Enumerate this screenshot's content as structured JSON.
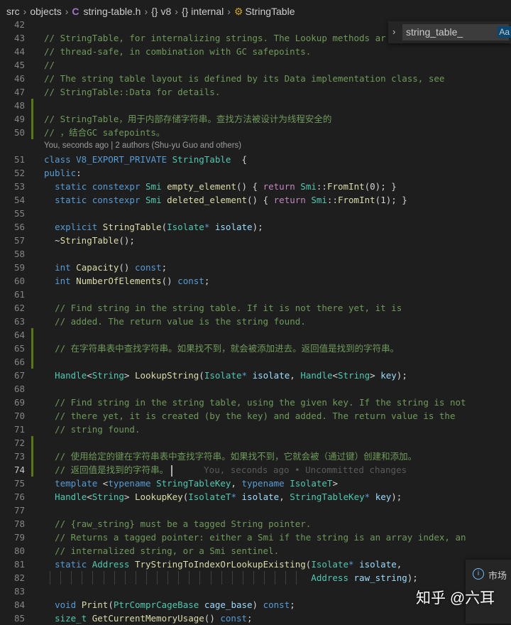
{
  "breadcrumb": [
    "src",
    "objects",
    "string-table.h",
    "v8",
    "internal",
    "StringTable"
  ],
  "find": {
    "value": "string_table_",
    "match_case_label": "Aa"
  },
  "colors": {
    "background": "#1e1e1e",
    "comment": "#6f9a5a",
    "keyword": "#569cd6",
    "type": "#4ec9b0",
    "function": "#dcdcaa",
    "control": "#c586c0",
    "variable": "#9cdcfe",
    "modified_gutter": "#587c0c"
  },
  "blame_header": "You, seconds ago | 2 authors (Shu-yu Guo and others)",
  "ghost_blame": "You, seconds ago • Uncommitted changes",
  "notification": {
    "icon": "info-icon",
    "text": "市场"
  },
  "watermark": "知乎 @六耳",
  "lines": [
    {
      "n": "42",
      "t": []
    },
    {
      "n": "43",
      "t": [
        [
          "c",
          "// StringTable, for internalizing strings. The Lookup methods ar"
        ]
      ]
    },
    {
      "n": "44",
      "t": [
        [
          "c",
          "// thread-safe, in combination with GC safepoints."
        ]
      ]
    },
    {
      "n": "45",
      "t": [
        [
          "c",
          "//"
        ]
      ]
    },
    {
      "n": "46",
      "t": [
        [
          "c",
          "// The string table layout is defined by its Data implementation class, see"
        ]
      ]
    },
    {
      "n": "47",
      "t": [
        [
          "c",
          "// StringTable::Data for details."
        ]
      ]
    },
    {
      "n": "48",
      "m": true,
      "t": []
    },
    {
      "n": "49",
      "m": true,
      "t": [
        [
          "c",
          "// StringTable，用于内部存储字符串。查找方法被设计为线程安全的"
        ]
      ]
    },
    {
      "n": "50",
      "m": true,
      "t": [
        [
          "c",
          "// ，结合GC safepoints。"
        ]
      ],
      "blame": true
    },
    {
      "n": "51",
      "t": [
        [
          "k",
          "class "
        ],
        [
          "k",
          "V8_EXPORT_PRIVATE "
        ],
        [
          "t",
          "StringTable"
        ],
        [
          "",
          "  {"
        ]
      ]
    },
    {
      "n": "52",
      "t": [
        [
          "",
          ""
        ],
        [
          "k",
          "public"
        ],
        [
          "",
          ":"
        ]
      ]
    },
    {
      "n": "53",
      "t": [
        [
          "",
          "  "
        ],
        [
          "k",
          "static "
        ],
        [
          "k",
          "constexpr "
        ],
        [
          "t",
          "Smi "
        ],
        [
          "f",
          "empty_element"
        ],
        [
          "",
          "() { "
        ],
        [
          "r",
          "return "
        ],
        [
          "t",
          "Smi"
        ],
        [
          "",
          "::"
        ],
        [
          "f",
          "FromInt"
        ],
        [
          "",
          "(0); }"
        ]
      ]
    },
    {
      "n": "54",
      "t": [
        [
          "",
          "  "
        ],
        [
          "k",
          "static "
        ],
        [
          "k",
          "constexpr "
        ],
        [
          "t",
          "Smi "
        ],
        [
          "f",
          "deleted_element"
        ],
        [
          "",
          "() { "
        ],
        [
          "r",
          "return "
        ],
        [
          "t",
          "Smi"
        ],
        [
          "",
          "::"
        ],
        [
          "f",
          "FromInt"
        ],
        [
          "",
          "(1); }"
        ]
      ]
    },
    {
      "n": "55",
      "t": []
    },
    {
      "n": "56",
      "t": [
        [
          "",
          "  "
        ],
        [
          "k",
          "explicit "
        ],
        [
          "f",
          "StringTable"
        ],
        [
          "",
          "("
        ],
        [
          "t",
          "Isolate"
        ],
        [
          "k",
          "* "
        ],
        [
          "v",
          "isolate"
        ],
        [
          "",
          ");"
        ]
      ]
    },
    {
      "n": "57",
      "t": [
        [
          "",
          "  ~"
        ],
        [
          "f",
          "StringTable"
        ],
        [
          "",
          "();"
        ]
      ]
    },
    {
      "n": "58",
      "t": []
    },
    {
      "n": "59",
      "t": [
        [
          "",
          "  "
        ],
        [
          "k",
          "int "
        ],
        [
          "f",
          "Capacity"
        ],
        [
          "",
          "() "
        ],
        [
          "k",
          "const"
        ],
        [
          "",
          ";"
        ]
      ]
    },
    {
      "n": "60",
      "t": [
        [
          "",
          "  "
        ],
        [
          "k",
          "int "
        ],
        [
          "f",
          "NumberOfElements"
        ],
        [
          "",
          "() "
        ],
        [
          "k",
          "const"
        ],
        [
          "",
          ";"
        ]
      ]
    },
    {
      "n": "61",
      "t": []
    },
    {
      "n": "62",
      "t": [
        [
          "",
          "  "
        ],
        [
          "c",
          "// Find string in the string table. If it is not there yet, it is"
        ]
      ]
    },
    {
      "n": "63",
      "t": [
        [
          "",
          "  "
        ],
        [
          "c",
          "// added. The return value is the string found."
        ]
      ]
    },
    {
      "n": "64",
      "m": true,
      "t": []
    },
    {
      "n": "65",
      "m": true,
      "t": [
        [
          "",
          "  "
        ],
        [
          "c",
          "// 在字符串表中查找字符串。如果找不到，就会被添加进去。返回值是找到的字符串。"
        ]
      ]
    },
    {
      "n": "66",
      "m": true,
      "t": []
    },
    {
      "n": "67",
      "t": [
        [
          "",
          "  "
        ],
        [
          "t",
          "Handle"
        ],
        [
          "",
          "<"
        ],
        [
          "t",
          "String"
        ],
        [
          "",
          "> "
        ],
        [
          "f",
          "LookupString"
        ],
        [
          "",
          "("
        ],
        [
          "t",
          "Isolate"
        ],
        [
          "k",
          "* "
        ],
        [
          "v",
          "isolate"
        ],
        [
          "",
          ", "
        ],
        [
          "t",
          "Handle"
        ],
        [
          "",
          "<"
        ],
        [
          "t",
          "String"
        ],
        [
          "",
          "> "
        ],
        [
          "v",
          "key"
        ],
        [
          "",
          ");"
        ]
      ]
    },
    {
      "n": "68",
      "t": []
    },
    {
      "n": "69",
      "t": [
        [
          "",
          "  "
        ],
        [
          "c",
          "// Find string in the string table, using the given key. If the string is not"
        ]
      ]
    },
    {
      "n": "70",
      "t": [
        [
          "",
          "  "
        ],
        [
          "c",
          "// there yet, it is created (by the key) and added. The return value is the"
        ]
      ]
    },
    {
      "n": "71",
      "t": [
        [
          "",
          "  "
        ],
        [
          "c",
          "// string found."
        ]
      ]
    },
    {
      "n": "72",
      "m": true,
      "t": []
    },
    {
      "n": "73",
      "m": true,
      "t": [
        [
          "",
          "  "
        ],
        [
          "c",
          "// 使用给定的键在字符串表中查找字符串。如果找不到，它就会被（通过键）创建和添加。"
        ]
      ]
    },
    {
      "n": "74",
      "m": true,
      "cur": true,
      "t": [
        [
          "",
          "  "
        ],
        [
          "c",
          "// 返回值是找到的字符串。"
        ]
      ]
    },
    {
      "n": "75",
      "t": [
        [
          "",
          "  "
        ],
        [
          "k",
          "template "
        ],
        [
          "",
          "<"
        ],
        [
          "k",
          "typename "
        ],
        [
          "t",
          "StringTableKey"
        ],
        [
          "",
          ", "
        ],
        [
          "k",
          "typename "
        ],
        [
          "t",
          "IsolateT"
        ],
        [
          "",
          ">"
        ]
      ]
    },
    {
      "n": "76",
      "t": [
        [
          "",
          "  "
        ],
        [
          "t",
          "Handle"
        ],
        [
          "",
          "<"
        ],
        [
          "t",
          "String"
        ],
        [
          "",
          "> "
        ],
        [
          "f",
          "LookupKey"
        ],
        [
          "",
          "("
        ],
        [
          "t",
          "IsolateT"
        ],
        [
          "k",
          "* "
        ],
        [
          "v",
          "isolate"
        ],
        [
          "",
          ", "
        ],
        [
          "t",
          "StringTableKey"
        ],
        [
          "k",
          "* "
        ],
        [
          "v",
          "key"
        ],
        [
          "",
          ");"
        ]
      ]
    },
    {
      "n": "77",
      "t": []
    },
    {
      "n": "78",
      "t": [
        [
          "",
          "  "
        ],
        [
          "c",
          "// {raw_string} must be a tagged String pointer."
        ]
      ]
    },
    {
      "n": "79",
      "t": [
        [
          "",
          "  "
        ],
        [
          "c",
          "// Returns a tagged pointer: either a Smi if the string is an array index, an"
        ]
      ]
    },
    {
      "n": "80",
      "t": [
        [
          "",
          "  "
        ],
        [
          "c",
          "// internalized string, or a Smi sentinel."
        ]
      ]
    },
    {
      "n": "81",
      "t": [
        [
          "",
          "  "
        ],
        [
          "k",
          "static "
        ],
        [
          "t",
          "Address "
        ],
        [
          "f",
          "TryStringToIndexOrLookupExisting"
        ],
        [
          "",
          "("
        ],
        [
          "t",
          "Isolate"
        ],
        [
          "k",
          "* "
        ],
        [
          "v",
          "isolate"
        ],
        [
          "",
          ","
        ]
      ]
    },
    {
      "n": "82",
      "g": true,
      "t": [
        [
          "",
          "                                                  "
        ],
        [
          "t",
          "Address "
        ],
        [
          "v",
          "raw_string"
        ],
        [
          "",
          ");"
        ]
      ]
    },
    {
      "n": "83",
      "t": []
    },
    {
      "n": "84",
      "t": [
        [
          "",
          "  "
        ],
        [
          "k",
          "void "
        ],
        [
          "f",
          "Print"
        ],
        [
          "",
          "("
        ],
        [
          "t",
          "PtrComprCageBase "
        ],
        [
          "v",
          "cage_base"
        ],
        [
          "",
          ") "
        ],
        [
          "k",
          "const"
        ],
        [
          "",
          ";"
        ]
      ]
    },
    {
      "n": "85",
      "t": [
        [
          "",
          "  "
        ],
        [
          "t",
          "size_t "
        ],
        [
          "f",
          "GetCurrentMemoryUsage"
        ],
        [
          "",
          "() "
        ],
        [
          "k",
          "const"
        ],
        [
          "",
          ";"
        ]
      ]
    }
  ]
}
